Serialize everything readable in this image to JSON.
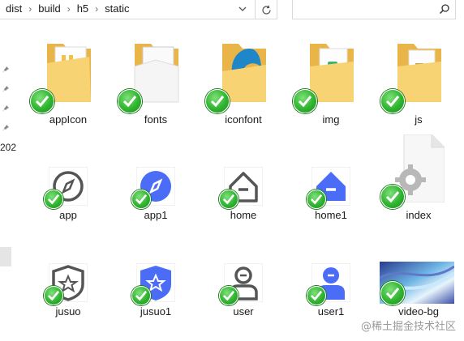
{
  "breadcrumb": [
    "dist",
    "build",
    "h5",
    "static"
  ],
  "search": {
    "placeholder": ""
  },
  "nav": {
    "truncated_label": "202"
  },
  "items": [
    {
      "name": "appIcon",
      "kind": "folder-page"
    },
    {
      "name": "fonts",
      "kind": "folder-fonts"
    },
    {
      "name": "iconfont",
      "kind": "folder-edge"
    },
    {
      "name": "img",
      "kind": "folder-img"
    },
    {
      "name": "js",
      "kind": "folder-js"
    },
    {
      "name": "app",
      "kind": "compass-outline"
    },
    {
      "name": "app1",
      "kind": "compass-filled"
    },
    {
      "name": "home",
      "kind": "home-outline"
    },
    {
      "name": "home1",
      "kind": "home-filled"
    },
    {
      "name": "index",
      "kind": "settings-file"
    },
    {
      "name": "jusuo",
      "kind": "shield-outline"
    },
    {
      "name": "jusuo1",
      "kind": "shield-filled"
    },
    {
      "name": "user",
      "kind": "user-outline"
    },
    {
      "name": "user1",
      "kind": "user-filled"
    },
    {
      "name": "video-bg",
      "kind": "image-thumb"
    }
  ],
  "watermark": "@稀土掘金技术社区",
  "colors": {
    "accent": "#4a6cf7",
    "folder": "#f6c85f",
    "badge": "#2fb52f"
  }
}
